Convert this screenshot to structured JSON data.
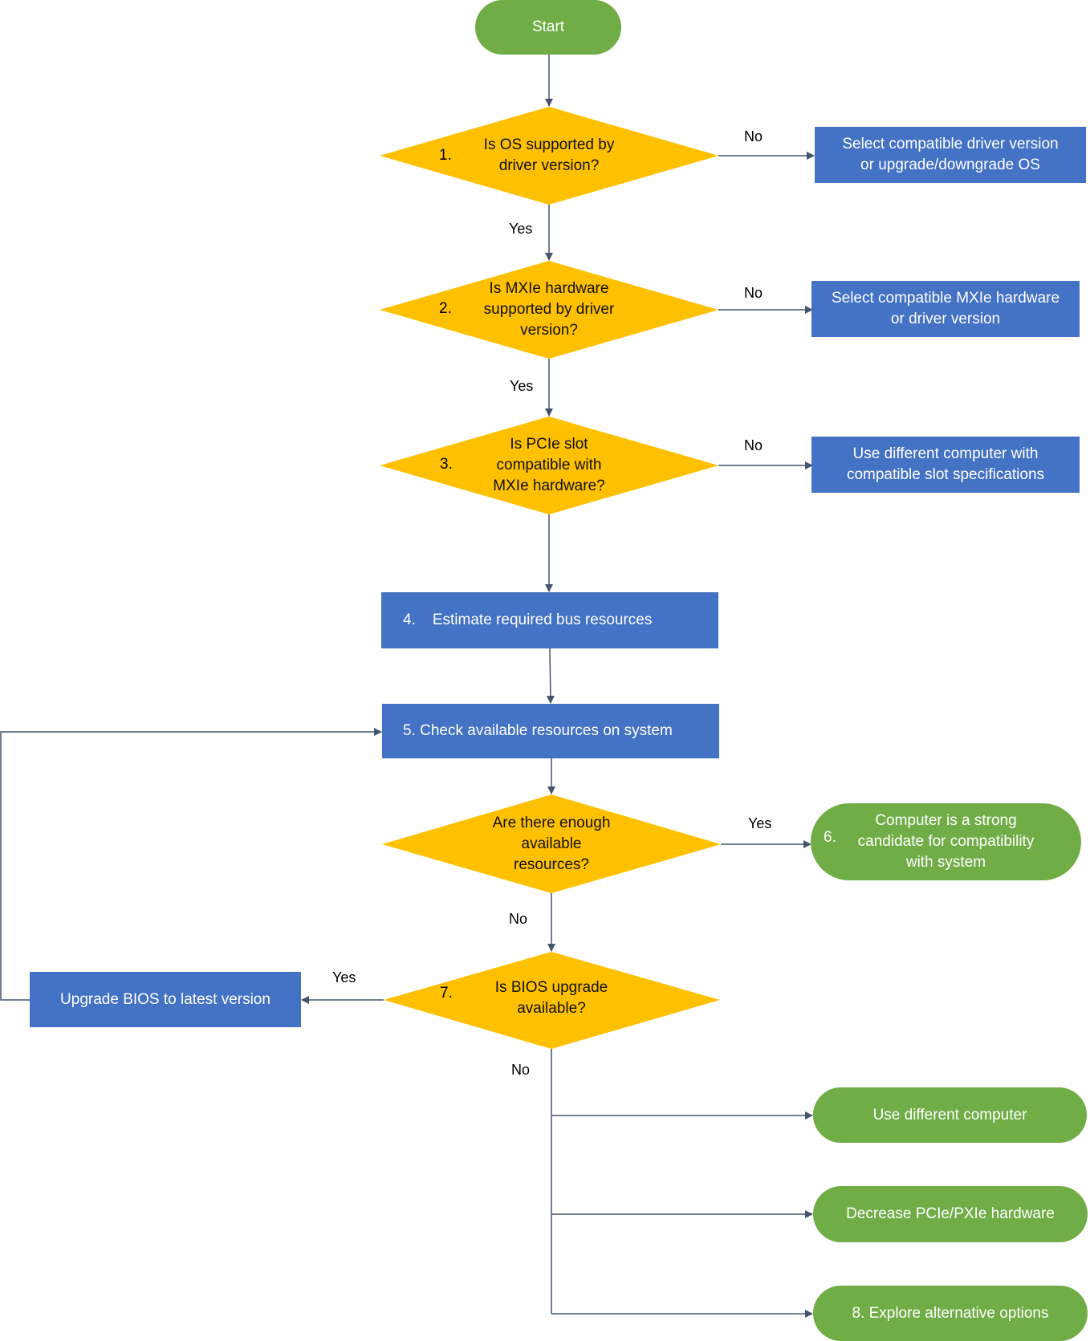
{
  "colors": {
    "process": "#4472c4",
    "terminal": "#70ad47",
    "decision": "#ffc000",
    "connector": "#44546a",
    "node_text_light": "#ffffff",
    "node_text_dark": "#111111"
  },
  "nodes": {
    "start": {
      "text": "Start"
    },
    "d1": {
      "num": "1.",
      "text": "Is OS supported by\ndriver version?"
    },
    "r1": {
      "text": "Select compatible driver version\nor upgrade/downgrade OS"
    },
    "d2": {
      "num": "2.",
      "text": "Is MXIe hardware\nsupported by driver\nversion?"
    },
    "r2": {
      "text": "Select compatible MXIe hardware\nor driver version"
    },
    "d3": {
      "num": "3.",
      "text": "Is PCIe slot\ncompatible with\nMXIe hardware?"
    },
    "r3": {
      "text": "Use different computer with\ncompatible slot specifications"
    },
    "p4": {
      "num": "4.",
      "text": "Estimate required bus resources"
    },
    "p5": {
      "text": "5. Check available resources on system"
    },
    "d5": {
      "text": "Are there enough\navailable\nresources?"
    },
    "t6": {
      "num": "6.",
      "text": "Computer is a strong\ncandidate for compatibility\nwith system"
    },
    "d7": {
      "num": "7.",
      "text": "Is BIOS upgrade\navailable?"
    },
    "bios": {
      "text": "Upgrade BIOS to latest version"
    },
    "t_diff": {
      "text": "Use different computer"
    },
    "t_dec": {
      "text": "Decrease PCIe/PXIe hardware"
    },
    "t8": {
      "text": "8.  Explore alternative options"
    }
  },
  "edges": {
    "d1_no": "No",
    "d1_yes": "Yes",
    "d2_no": "No",
    "d2_yes": "Yes",
    "d3_no": "No",
    "d5_yes": "Yes",
    "d5_no": "No",
    "d7_yes": "Yes",
    "d7_no": "No"
  }
}
